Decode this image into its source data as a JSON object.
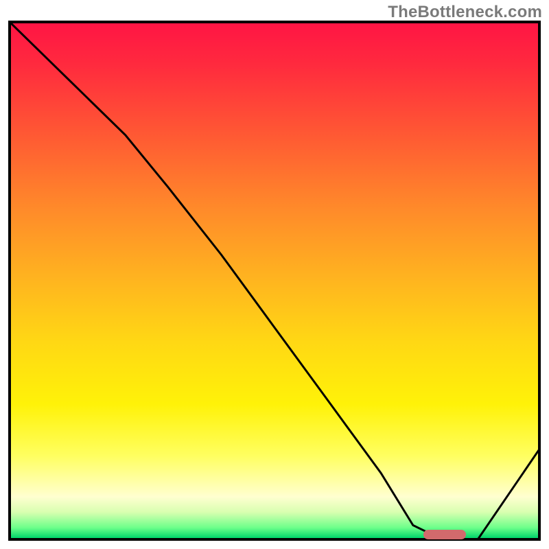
{
  "watermark": "TheBottleneck.com",
  "chart_data": {
    "type": "line",
    "title": "",
    "xlabel": "",
    "ylabel": "",
    "xlim": [
      0,
      100
    ],
    "ylim": [
      0,
      100
    ],
    "grid": false,
    "legend": false,
    "series": [
      {
        "name": "bottleneck-curve",
        "x": [
          0,
          10,
          22,
          30,
          40,
          50,
          60,
          70,
          76,
          82,
          88,
          100
        ],
        "y": [
          100,
          90,
          78,
          68,
          55,
          41,
          27,
          13,
          3,
          0,
          0,
          18
        ]
      }
    ],
    "marker": {
      "name": "optimal-range",
      "x_start": 78,
      "x_end": 86,
      "y": 0
    },
    "gradient_stops": [
      {
        "pos": 0,
        "color": "#ff1544"
      },
      {
        "pos": 50,
        "color": "#ffb51f"
      },
      {
        "pos": 80,
        "color": "#ffff60"
      },
      {
        "pos": 100,
        "color": "#00d46b"
      }
    ]
  }
}
